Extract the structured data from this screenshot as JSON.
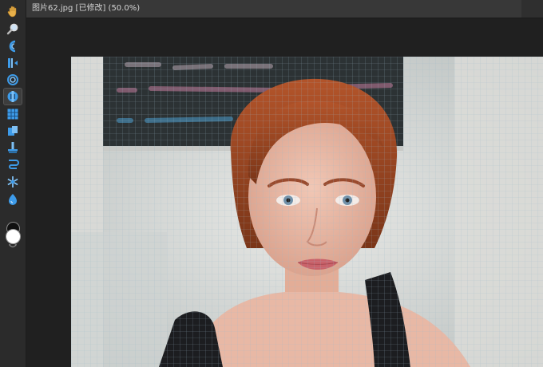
{
  "document": {
    "tab_title": "图片62.jpg [已修改] (50.0%)"
  },
  "toolbar": {
    "tools": [
      {
        "name": "hand-tool",
        "icon": "hand-icon"
      },
      {
        "name": "zoom-tool",
        "icon": "magnifier-icon"
      },
      {
        "name": "forward-warp-tool",
        "icon": "warp-icon"
      },
      {
        "name": "reconstruct-tool",
        "icon": "reconstruct-icon"
      },
      {
        "name": "twirl-tool",
        "icon": "twirl-icon"
      },
      {
        "name": "pucker-tool",
        "icon": "pucker-icon",
        "active": true
      },
      {
        "name": "bloat-tool",
        "icon": "bloat-icon"
      },
      {
        "name": "push-left-tool",
        "icon": "push-left-icon"
      },
      {
        "name": "mirror-tool",
        "icon": "mirror-icon"
      },
      {
        "name": "turbulence-tool",
        "icon": "turbulence-icon"
      },
      {
        "name": "freeze-mask-tool",
        "icon": "freeze-icon"
      },
      {
        "name": "thaw-mask-tool",
        "icon": "thaw-icon"
      }
    ],
    "foreground_color": "#111111",
    "background_color": "#ffffff",
    "accent": "#3d9be9"
  }
}
